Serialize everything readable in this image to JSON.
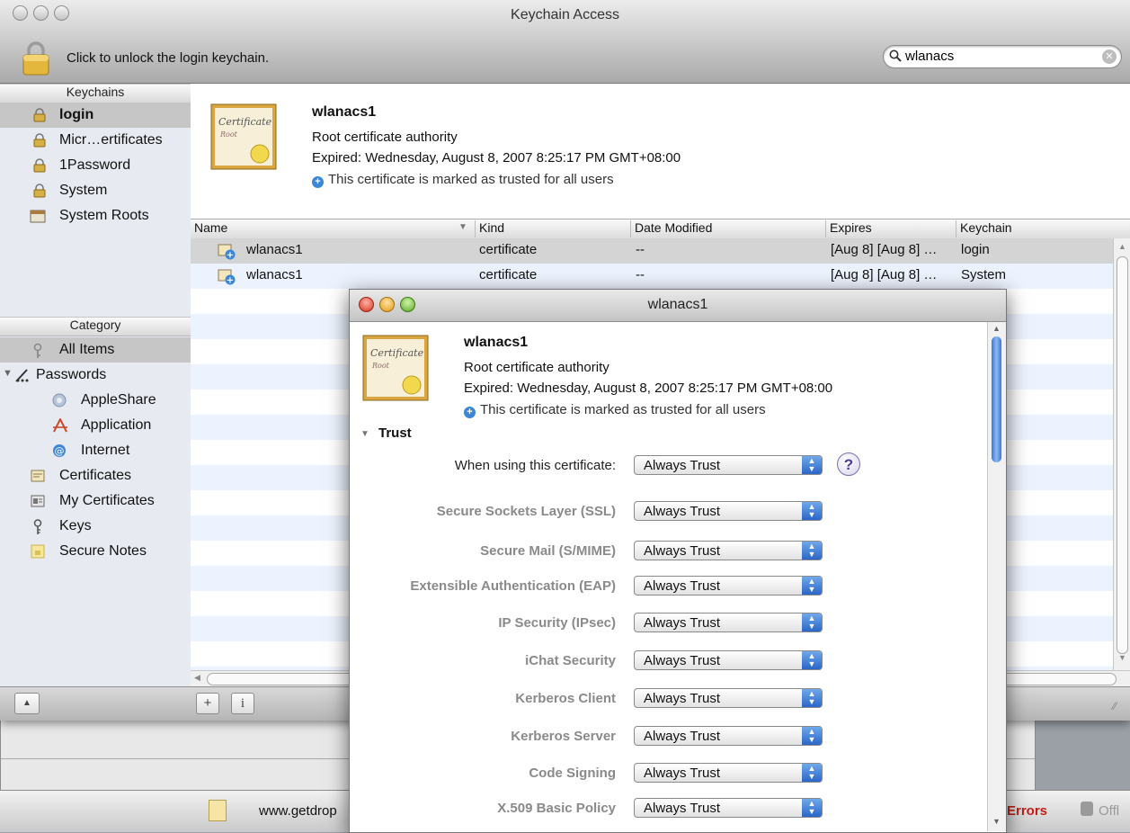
{
  "window": {
    "title": "Keychain Access"
  },
  "toolbar": {
    "unlock_text": "Click to unlock the login keychain.",
    "search_value": "wlanacs"
  },
  "sidebar": {
    "keychains_header": "Keychains",
    "keychains": [
      {
        "label": "login",
        "icon": "lock-icon",
        "selected": true
      },
      {
        "label": "Micr…ertificates",
        "icon": "lock-icon"
      },
      {
        "label": "1Password",
        "icon": "lock-icon"
      },
      {
        "label": "System",
        "icon": "lock-icon"
      },
      {
        "label": "System Roots",
        "icon": "cabinet-icon"
      }
    ],
    "category_header": "Category",
    "categories": [
      {
        "label": "All Items",
        "icon": "all-items-icon",
        "selected": true
      },
      {
        "label": "Passwords",
        "icon": "passwords-icon"
      },
      {
        "label": "AppleShare",
        "icon": "appleshare-icon"
      },
      {
        "label": "Application",
        "icon": "application-icon"
      },
      {
        "label": "Internet",
        "icon": "internet-icon"
      },
      {
        "label": "Certificates",
        "icon": "certificate-icon"
      },
      {
        "label": "My Certificates",
        "icon": "my-certificate-icon"
      },
      {
        "label": "Keys",
        "icon": "key-icon"
      },
      {
        "label": "Secure Notes",
        "icon": "secure-note-icon"
      }
    ]
  },
  "cert": {
    "icon_text": "Certificate",
    "icon_subtext": "Root",
    "name": "wlanacs1",
    "type": "Root certificate authority",
    "expired": "Expired: Wednesday, August 8, 2007 8:25:17 PM GMT+08:00",
    "trust_note": "This certificate is marked as trusted for all users"
  },
  "table": {
    "columns": [
      "Name",
      "Kind",
      "Date Modified",
      "Expires",
      "Keychain"
    ],
    "rows": [
      {
        "name": "wlanacs1",
        "kind": "certificate",
        "modified": "--",
        "expires": "[Aug 8] [Aug 8] …",
        "keychain": "login"
      },
      {
        "name": "wlanacs1",
        "kind": "certificate",
        "modified": "--",
        "expires": "[Aug 8] [Aug 8] …",
        "keychain": "System"
      }
    ]
  },
  "statusbar": {
    "add_label": "+",
    "info_label": "i"
  },
  "dialog": {
    "title": "wlanacs1",
    "trust_section": "Trust",
    "when_label": "When using this certificate:",
    "when_value": "Always Trust",
    "help_label": "?",
    "policies": [
      {
        "label": "Secure Sockets Layer (SSL)",
        "value": "Always Trust"
      },
      {
        "label": "Secure Mail (S/MIME)",
        "value": "Always Trust"
      },
      {
        "label": "Extensible Authentication (EAP)",
        "value": "Always Trust"
      },
      {
        "label": "IP Security (IPsec)",
        "value": "Always Trust"
      },
      {
        "label": "iChat Security",
        "value": "Always Trust"
      },
      {
        "label": "Kerberos Client",
        "value": "Always Trust"
      },
      {
        "label": "Kerberos Server",
        "value": "Always Trust"
      },
      {
        "label": "Code Signing",
        "value": "Always Trust"
      },
      {
        "label": "X.509 Basic Policy",
        "value": "Always Trust"
      }
    ]
  },
  "background": {
    "url_fragment": "www.getdrop",
    "errors_label": "Errors",
    "offline_label": "Offl"
  },
  "colors": {
    "selection_gray": "#c6c6c6",
    "stripe_blue": "#edf3fe",
    "accent_blue": "#3a86d8",
    "errors_red": "#c0201b"
  }
}
